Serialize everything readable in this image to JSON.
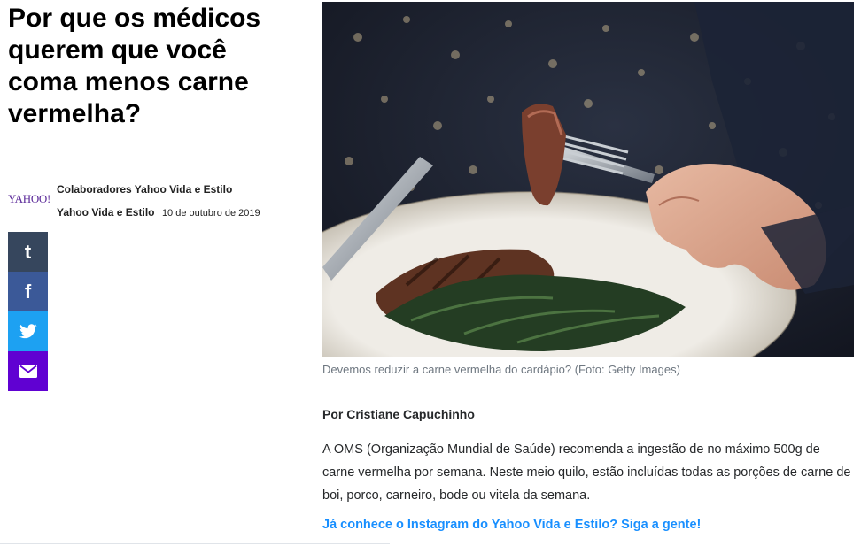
{
  "article": {
    "headline": "Por que os médicos querem que você coma menos carne vermelha?",
    "provider_logo": "YAHOO!",
    "author": "Colaboradores Yahoo Vida e Estilo",
    "provider": "Yahoo Vida e Estilo",
    "date": "10 de outubro de 2019",
    "caption": "Devemos reduzir a carne vermelha do cardápio? (Foto: Getty Images)",
    "byline": "Por Cristiane Capuchinho",
    "paragraph": "A OMS (Organização Mundial de Saúde) recomenda a ingestão de no máximo 500g de carne vermelha por semana. Neste meio quilo, estão incluídas todas as porções de carne de boi, porco, carneiro, bode ou vitela da semana.",
    "promo_link": "Já conhece o Instagram do Yahoo Vida e Estilo? Siga a gente!"
  },
  "share": {
    "buttons": [
      {
        "icon": "tumblr-icon",
        "glyph": "t",
        "color": "#36465d"
      },
      {
        "icon": "facebook-icon",
        "glyph": "f",
        "color": "#3b5998"
      },
      {
        "icon": "twitter-icon",
        "glyph": "bird",
        "color": "#1da1f2"
      },
      {
        "icon": "email-icon",
        "glyph": "envelope",
        "color": "#6001d2"
      }
    ]
  },
  "colors": {
    "link": "#188fff",
    "caption": "#6e7780",
    "yahoo_purple": "#5c2b9a"
  }
}
